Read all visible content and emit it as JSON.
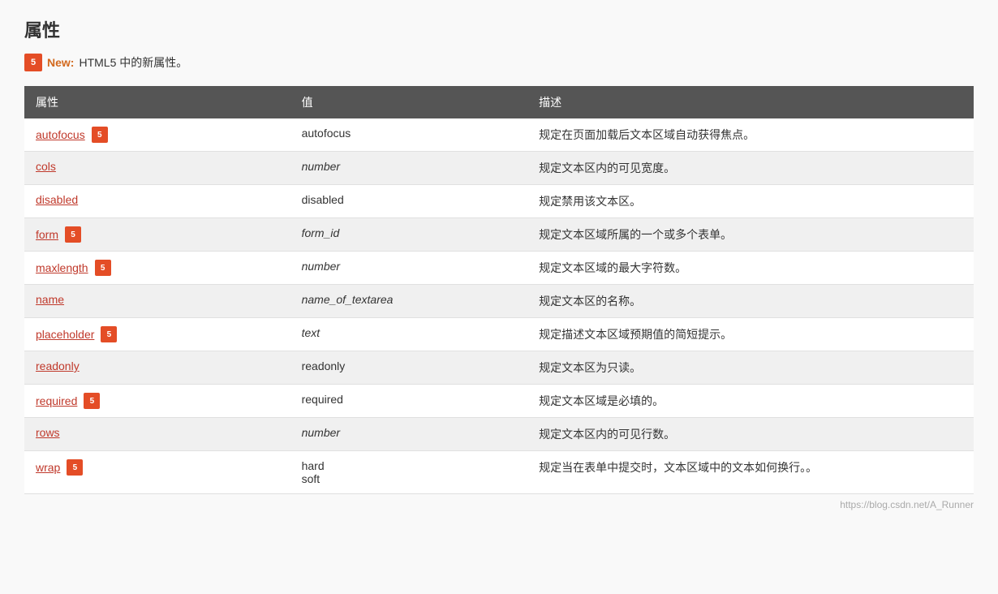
{
  "page": {
    "title": "属性",
    "html5_note": {
      "badge": "5",
      "new_label": "New:",
      "note_text": "HTML5 中的新属性。"
    },
    "watermark": "https://blog.csdn.net/A_Runner"
  },
  "table": {
    "headers": [
      "属性",
      "值",
      "描述"
    ],
    "rows": [
      {
        "attr": "autofocus",
        "html5": true,
        "value": "autofocus",
        "value_italic": false,
        "desc": "规定在页面加载后文本区域自动获得焦点。"
      },
      {
        "attr": "cols",
        "html5": false,
        "value": "number",
        "value_italic": true,
        "desc": "规定文本区内的可见宽度。"
      },
      {
        "attr": "disabled",
        "html5": false,
        "value": "disabled",
        "value_italic": false,
        "desc": "规定禁用该文本区。"
      },
      {
        "attr": "form",
        "html5": true,
        "value": "form_id",
        "value_italic": true,
        "desc": "规定文本区域所属的一个或多个表单。"
      },
      {
        "attr": "maxlength",
        "html5": true,
        "value": "number",
        "value_italic": true,
        "desc": "规定文本区域的最大字符数。"
      },
      {
        "attr": "name",
        "html5": false,
        "value": "name_of_textarea",
        "value_italic": true,
        "desc": "规定文本区的名称。"
      },
      {
        "attr": "placeholder",
        "html5": true,
        "value": "text",
        "value_italic": true,
        "desc": "规定描述文本区域预期值的简短提示。"
      },
      {
        "attr": "readonly",
        "html5": false,
        "value": "readonly",
        "value_italic": false,
        "desc": "规定文本区为只读。"
      },
      {
        "attr": "required",
        "html5": true,
        "value": "required",
        "value_italic": false,
        "desc": "规定文本区域是必填的。"
      },
      {
        "attr": "rows",
        "html5": false,
        "value": "number",
        "value_italic": true,
        "desc": "规定文本区内的可见行数。"
      },
      {
        "attr": "wrap",
        "html5": true,
        "value": "hard\nsoft",
        "value_italic": false,
        "desc": "规定当在表单中提交时，文本区域中的文本如何换行。。"
      }
    ]
  }
}
